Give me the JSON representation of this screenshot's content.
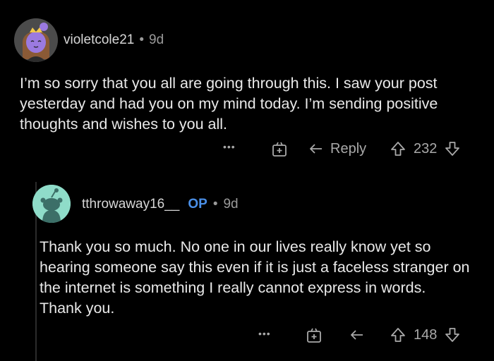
{
  "comments": [
    {
      "author": "violetcole21",
      "time": "9d",
      "body": "I’m so sorry that you all are going through this. I saw your post yesterday and had you on my mind today. I’m sending positive thoughts and wishes to you all.",
      "actions": {
        "more": "•••",
        "reply": "Reply",
        "score": "232"
      }
    },
    {
      "author": "tthrowaway16__",
      "op_tag": "OP",
      "time": "9d",
      "body": "Thank you so much. No one in our lives really know yet so hearing someone say this even if it is just a faceless stranger on the internet is something I really cannot express in words. Thank you.",
      "actions": {
        "more": "•••",
        "score": "148"
      }
    }
  ],
  "separator": "•",
  "colors": {
    "background": "#000000",
    "op_accent": "#4a8fe7",
    "text": "#e9e9e9",
    "muted": "#9a9a9a"
  }
}
